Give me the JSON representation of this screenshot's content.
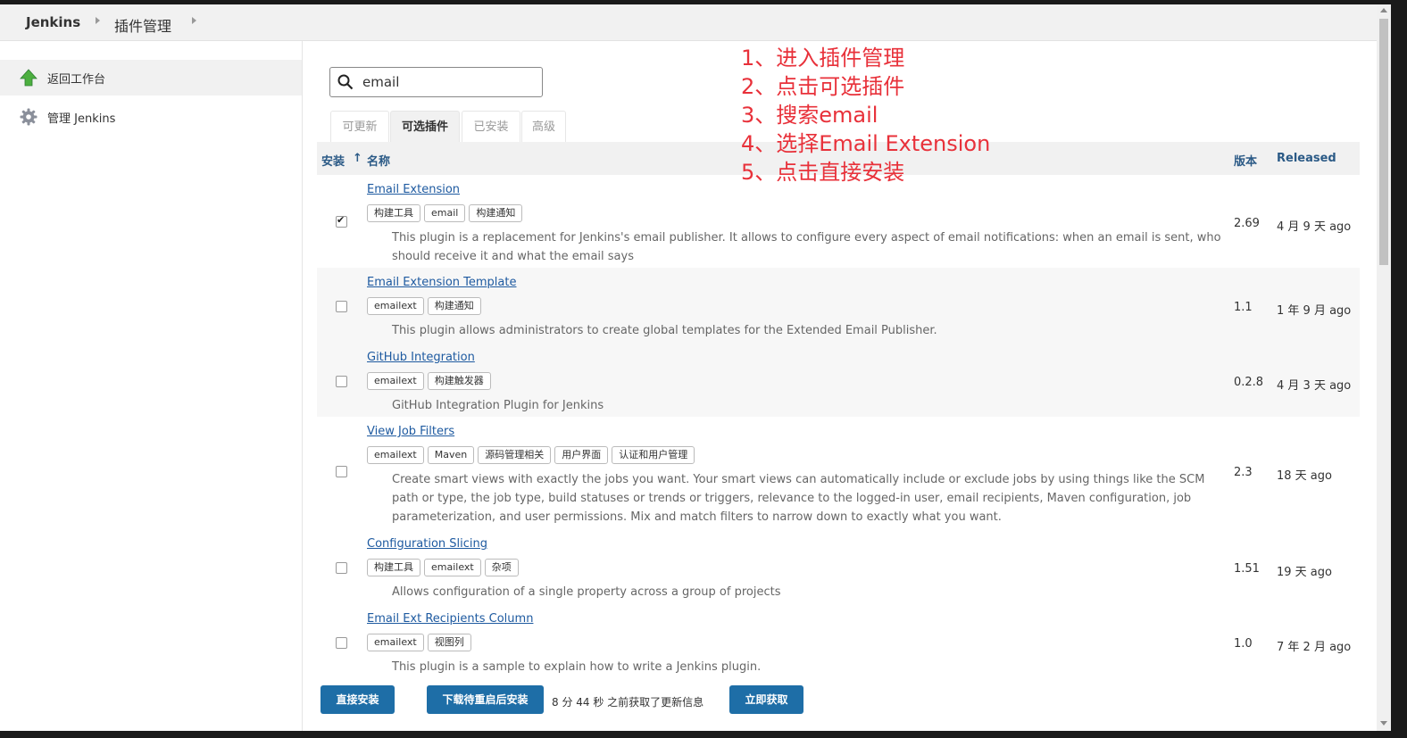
{
  "header": {
    "app": "Jenkins",
    "page": "插件管理"
  },
  "sidebar": {
    "items": [
      {
        "label": "返回工作台",
        "icon": "up-arrow-icon"
      },
      {
        "label": "管理 Jenkins",
        "icon": "gear-icon"
      }
    ]
  },
  "search": {
    "value": "email",
    "icon": "search-icon"
  },
  "tabs": [
    {
      "label": "可更新",
      "active": false
    },
    {
      "label": "可选插件",
      "active": true
    },
    {
      "label": "已安装",
      "active": false
    },
    {
      "label": "高级",
      "active": false
    }
  ],
  "table": {
    "headers": {
      "install": "安装",
      "sort": "↑",
      "name": "名称",
      "version": "版本",
      "released": "Released"
    },
    "rows": [
      {
        "name": "Email Extension",
        "tags": [
          "构建工具",
          "email",
          "构建通知"
        ],
        "desc": "This plugin is a replacement for Jenkins's email publisher. It allows to configure every aspect of email notifications: when an email is sent, who should receive it and what the email says",
        "version": "2.69",
        "released": "4 月 9 天 ago",
        "checked": true
      },
      {
        "name": "Email Extension Template",
        "tags": [
          "emailext",
          "构建通知"
        ],
        "desc": "This plugin allows administrators to create global templates for the Extended Email Publisher.",
        "version": "1.1",
        "released": "1 年 9 月 ago",
        "checked": false
      },
      {
        "name": "GitHub Integration",
        "tags": [
          "emailext",
          "构建触发器"
        ],
        "desc": "GitHub Integration Plugin for Jenkins",
        "version": "0.2.8",
        "released": "4 月 3 天 ago",
        "checked": false
      },
      {
        "name": "View Job Filters",
        "tags": [
          "emailext",
          "Maven",
          "源码管理相关",
          "用户界面",
          "认证和用户管理"
        ],
        "desc": "Create smart views with exactly the jobs you want. Your smart views can automatically include or exclude jobs by using things like the SCM path or type, the job type, build statuses or trends or triggers, relevance to the logged-in user, email recipients, Maven configuration, job parameterization, and user permissions. Mix and match filters to narrow down to exactly what you want.",
        "version": "2.3",
        "released": "18 天 ago",
        "checked": false
      },
      {
        "name": "Configuration Slicing",
        "tags": [
          "构建工具",
          "emailext",
          "杂项"
        ],
        "desc": "Allows configuration of a single property across a group of projects",
        "version": "1.51",
        "released": "19 天 ago",
        "checked": false
      },
      {
        "name": "Email Ext Recipients Column",
        "tags": [
          "emailext",
          "视图列"
        ],
        "desc": "This plugin is a sample to explain how to write a Jenkins plugin.",
        "version": "1.0",
        "released": "7 年 2 月 ago",
        "checked": false
      }
    ]
  },
  "footer": {
    "install_now": "直接安装",
    "install_after_restart": "下载待重启后安装",
    "info": "8 分 44 秒 之前获取了更新信息",
    "check_now": "立即获取"
  },
  "annotation": {
    "color": "#e8313a",
    "steps": [
      "1、进入插件管理",
      "2、点击可选插件",
      "3、搜索email",
      "4、选择Email Extension",
      "5、点击直接安装"
    ]
  }
}
